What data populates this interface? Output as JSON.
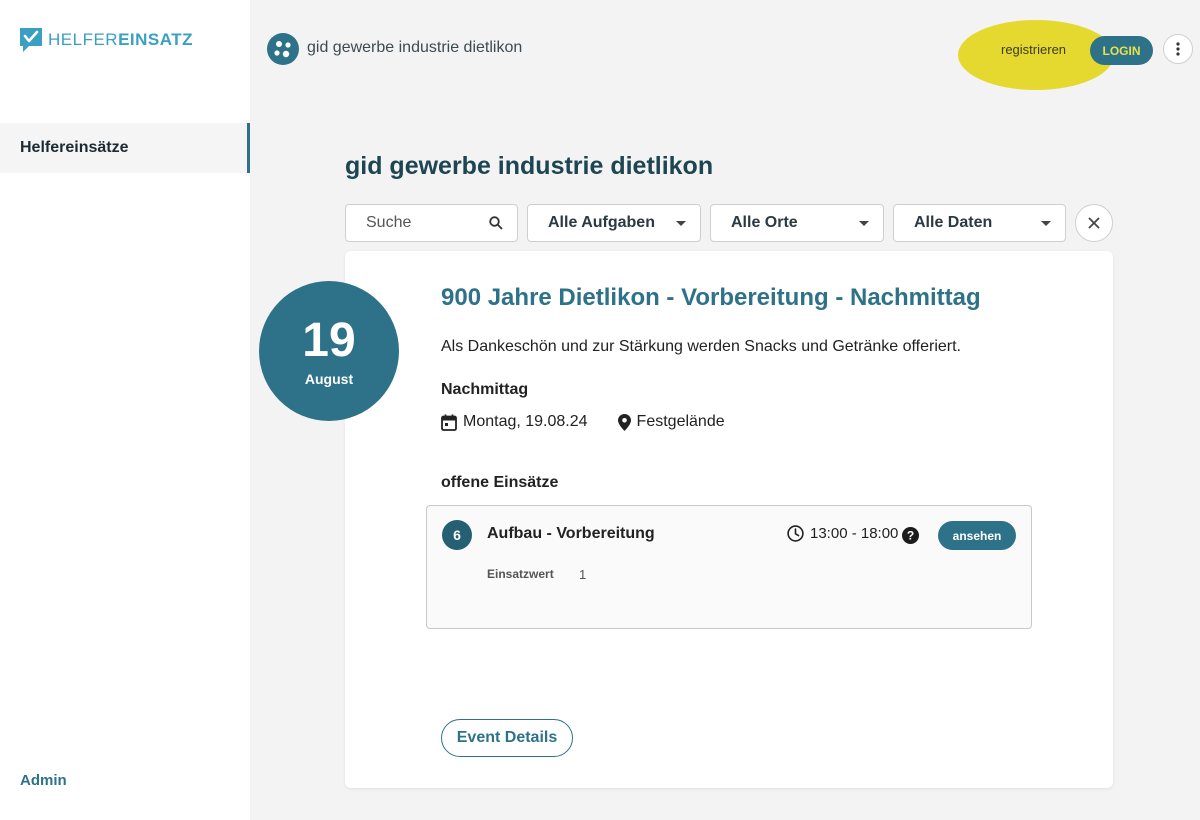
{
  "brand": {
    "logo_light": "HELFER",
    "logo_bold": "EINSATZ"
  },
  "sidebar": {
    "items": [
      {
        "label": "Helfereinsätze"
      }
    ],
    "admin_label": "Admin"
  },
  "header": {
    "org_name": "gid gewerbe industrie dietlikon",
    "register_label": "registrieren",
    "login_label": "LOGIN"
  },
  "main": {
    "title": "gid gewerbe industrie dietlikon",
    "filters": {
      "search_placeholder": "Suche",
      "tasks": "Alle Aufgaben",
      "places": "Alle Orte",
      "dates": "Alle Daten"
    }
  },
  "event": {
    "day": "19",
    "month": "August",
    "title": "900 Jahre Dietlikon - Vorbereitung - Nachmittag",
    "description": "Als Dankeschön und zur Stärkung werden Snacks und Getränke offeriert.",
    "slot": "Nachmittag",
    "date_text": "Montag, 19.08.24",
    "location": "Festgelände",
    "open_label": "offene Einsätze",
    "shifts": [
      {
        "count": "6",
        "name": "Aufbau - Vorbereitung",
        "time": "13:00 - 18:00",
        "view_label": "ansehen",
        "value_label": "Einsatzwert",
        "value": "1"
      }
    ],
    "details_label": "Event Details"
  },
  "colors": {
    "primary": "#2e7289",
    "logo_blue": "#3b9fc4",
    "highlight": "#e4d71e"
  }
}
